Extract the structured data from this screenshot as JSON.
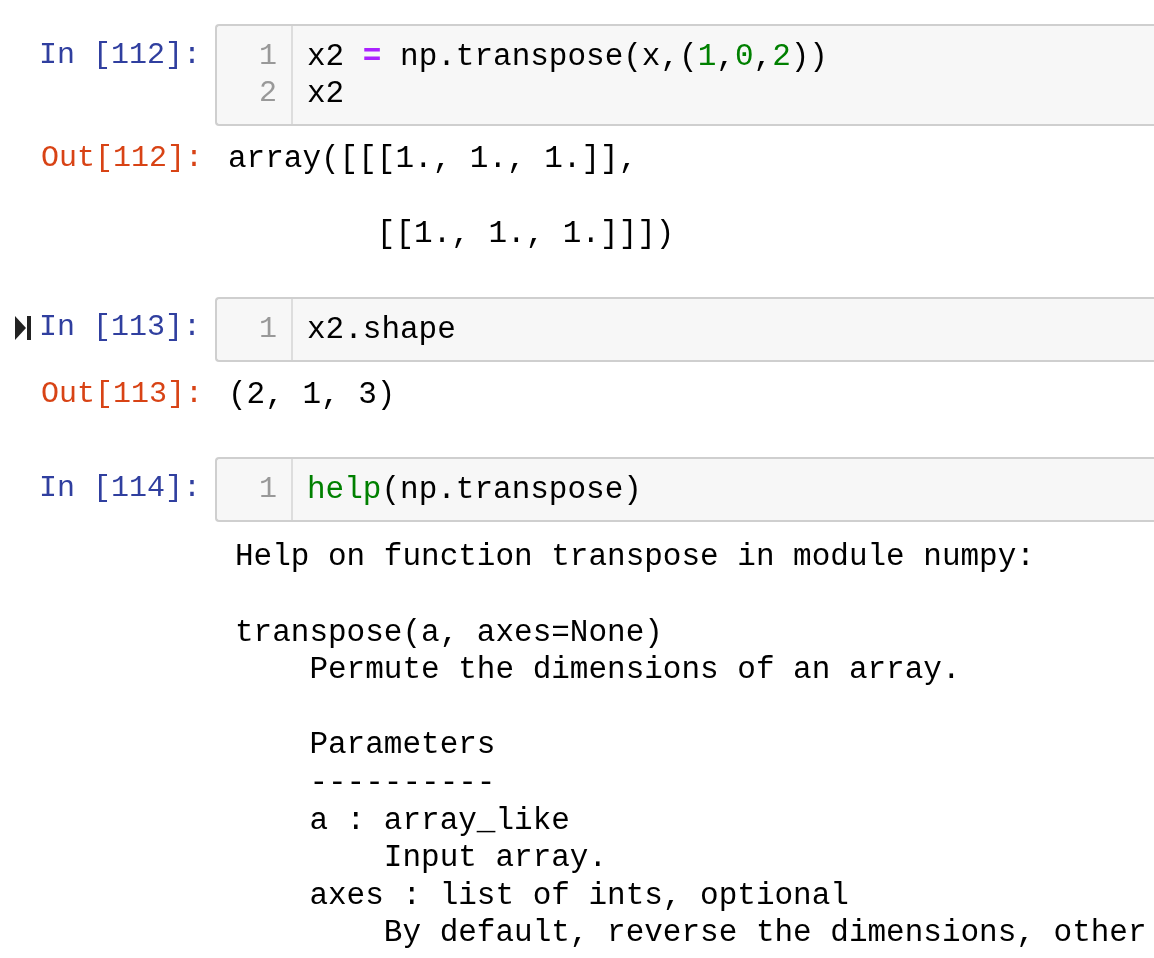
{
  "cells": [
    {
      "prompt": "In [112]:",
      "marked": false,
      "lines": [
        {
          "number": "1",
          "tokens": [
            {
              "kind": "text",
              "text": "x2 "
            },
            {
              "kind": "op",
              "text": "="
            },
            {
              "kind": "text",
              "text": " np.transpose(x,("
            },
            {
              "kind": "num",
              "text": "1"
            },
            {
              "kind": "text",
              "text": ","
            },
            {
              "kind": "num",
              "text": "0"
            },
            {
              "kind": "text",
              "text": ","
            },
            {
              "kind": "num",
              "text": "2"
            },
            {
              "kind": "text",
              "text": "))"
            }
          ]
        },
        {
          "number": "2",
          "tokens": [
            {
              "kind": "text",
              "text": "x2"
            }
          ]
        }
      ],
      "output": {
        "kind": "result",
        "prompt": "Out[112]:",
        "paragraphs": [
          [
            "array([[[1., 1., 1.]],"
          ],
          [
            "        [[1., 1., 1.]]])"
          ]
        ]
      }
    },
    {
      "prompt": "In [113]:",
      "marked": true,
      "lines": [
        {
          "number": "1",
          "tokens": [
            {
              "kind": "text",
              "text": "x2.shape"
            }
          ]
        }
      ],
      "output": {
        "kind": "result",
        "prompt": "Out[113]:",
        "paragraphs": [
          [
            "(2, 1, 3)"
          ]
        ]
      }
    },
    {
      "prompt": "In [114]:",
      "marked": false,
      "lines": [
        {
          "number": "1",
          "tokens": [
            {
              "kind": "builtin",
              "text": "help"
            },
            {
              "kind": "text",
              "text": "(np.transpose)"
            }
          ]
        }
      ],
      "output": {
        "kind": "stream",
        "paragraphs": [
          [
            "Help on function transpose in module numpy:"
          ],
          [
            "transpose(a, axes=None)",
            "    Permute the dimensions of an array."
          ],
          [
            "    Parameters",
            "    ----------",
            "    a : array_like",
            "        Input array.",
            "    axes : list of ints, optional",
            "        By default, reverse the dimensions, other"
          ]
        ]
      }
    }
  ]
}
